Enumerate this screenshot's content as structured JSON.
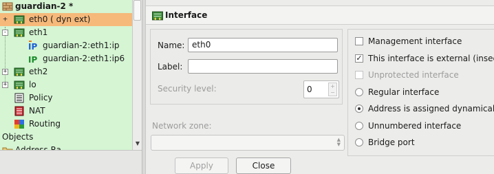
{
  "tree": {
    "root": {
      "label": "guardian-2 *",
      "icon": "firewall-icon"
    },
    "items": [
      {
        "label": "eth0 ( dyn ext)",
        "icon": "network-interface-icon",
        "expander": "+",
        "selected": true
      },
      {
        "label": "eth1",
        "icon": "network-interface-icon",
        "expander": "-"
      },
      {
        "label": "guardian-2:eth1:ip",
        "icon": "ip-address-icon"
      },
      {
        "label": "guardian-2:eth1:ip6",
        "icon": "ip-address-icon"
      },
      {
        "label": "eth2",
        "icon": "network-interface-icon",
        "expander": "+"
      },
      {
        "label": "lo",
        "icon": "network-interface-icon",
        "expander": "+"
      },
      {
        "label": "Policy",
        "icon": "policy-icon"
      },
      {
        "label": "NAT",
        "icon": "nat-icon"
      },
      {
        "label": "Routing",
        "icon": "routing-icon"
      }
    ],
    "objects": {
      "label": "Objects"
    },
    "partial": {
      "label": "Address Ra"
    }
  },
  "editor": {
    "header": {
      "title": "Interface",
      "icon": "network-interface-icon"
    },
    "name": {
      "label": "Name:",
      "value": "eth0"
    },
    "label_field": {
      "label": "Label:",
      "value": ""
    },
    "security_level": {
      "label": "Security level:",
      "value": "0"
    },
    "network_zone": {
      "label": "Network zone:",
      "value": ""
    },
    "options": [
      {
        "kind": "checkbox",
        "label": "Management interface",
        "checked": false,
        "enabled": true
      },
      {
        "kind": "checkbox",
        "label": "This interface is external (insecure)",
        "checked": true,
        "enabled": true
      },
      {
        "kind": "checkbox",
        "label": "Unprotected interface",
        "checked": false,
        "enabled": false
      },
      {
        "kind": "radio",
        "label": "Regular interface",
        "checked": false
      },
      {
        "kind": "radio",
        "label": "Address is assigned dynamically",
        "checked": true
      },
      {
        "kind": "radio",
        "label": "Unnumbered interface",
        "checked": false
      },
      {
        "kind": "radio",
        "label": "Bridge port",
        "checked": false
      }
    ],
    "buttons": {
      "apply": "Apply",
      "close": "Close"
    }
  },
  "colors": {
    "tree_bg": "#d5f5d3",
    "selection": "#f6b97a",
    "panel_bg": "#ececea"
  }
}
